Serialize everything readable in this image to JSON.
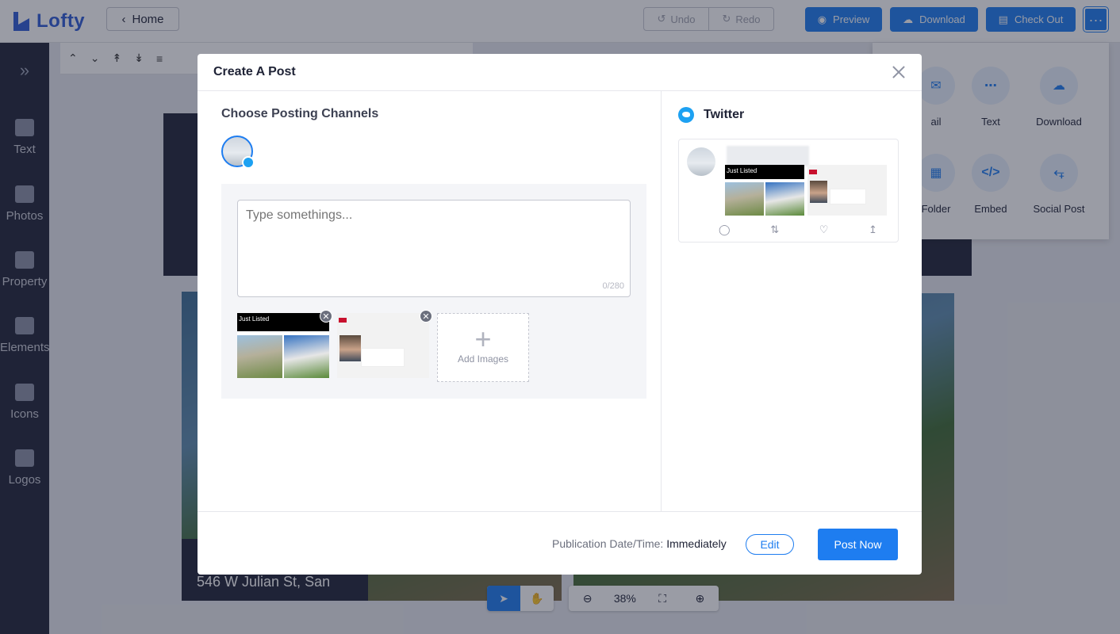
{
  "app": {
    "brand": "Lofty",
    "home_label": "Home",
    "undo_label": "Undo",
    "redo_label": "Redo",
    "preview_label": "Preview",
    "download_label": "Download",
    "checkout_label": "Check Out",
    "more_label": "···"
  },
  "sidebar": {
    "items": [
      {
        "label": "Text",
        "icon": "text-icon"
      },
      {
        "label": "Photos",
        "icon": "photos-icon"
      },
      {
        "label": "Property",
        "icon": "property-icon"
      },
      {
        "label": "Elements",
        "icon": "elements-icon"
      },
      {
        "label": "Icons",
        "icon": "icons-icon"
      },
      {
        "label": "Logos",
        "icon": "logos-icon"
      }
    ]
  },
  "share_menu": {
    "items": [
      {
        "label": "ail",
        "icon": "email-icon"
      },
      {
        "label": "Text",
        "icon": "chat-icon"
      },
      {
        "label": "Download",
        "icon": "cloud-download-icon"
      },
      {
        "label": "Folder",
        "icon": "folder-icon"
      },
      {
        "label": "Embed",
        "icon": "code-icon"
      },
      {
        "label": "Social Post",
        "icon": "share-icon"
      }
    ]
  },
  "canvas": {
    "address_text": "546 W Julian St, San",
    "zoom_level": "38%"
  },
  "modal": {
    "title": "Create A Post",
    "channels_title": "Choose Posting Channels",
    "textbox_placeholder": "Type somethings...",
    "char_count": "0/280",
    "add_images_label": "Add Images",
    "flyer_label": "Just Listed",
    "twitter_label": "Twitter",
    "publication_label": "Publication Date/Time:",
    "publication_value": "Immediately",
    "edit_label": "Edit",
    "post_label": "Post Now"
  },
  "colors": {
    "primary": "#1e7df0",
    "twitter": "#1da1f2",
    "sidebar_bg": "#202437"
  }
}
